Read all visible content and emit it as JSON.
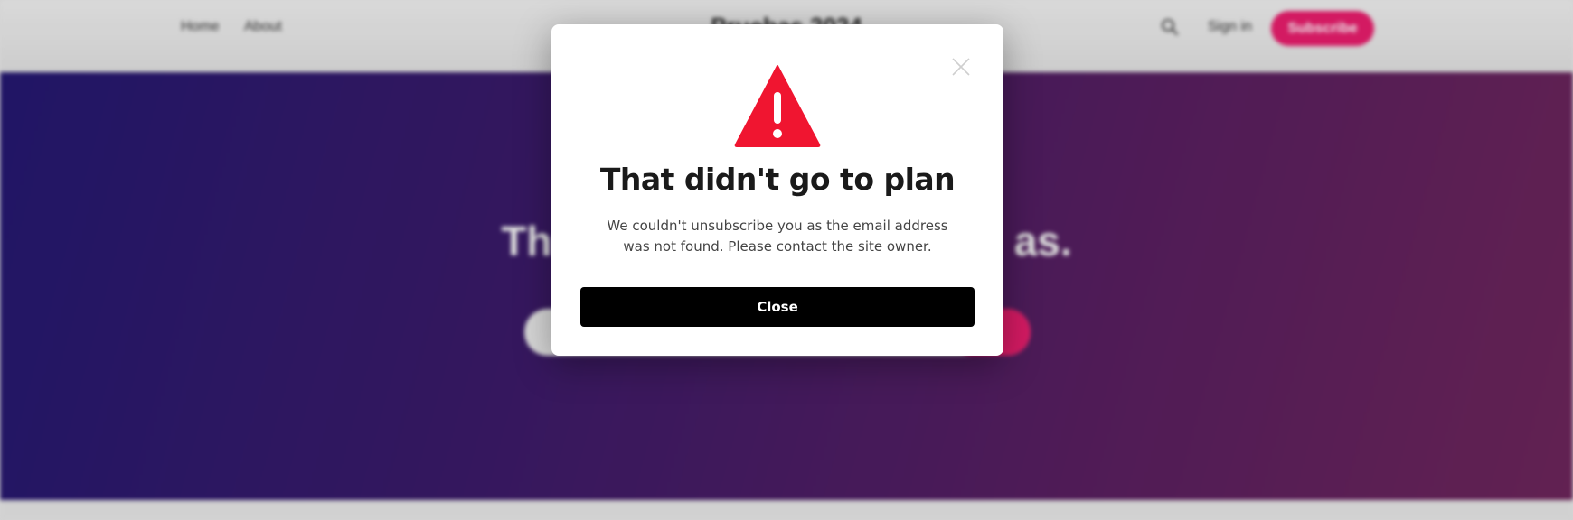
{
  "background": {
    "nav": {
      "links": [
        "Home",
        "About"
      ],
      "site_title": "Pruebas 2024",
      "search_icon": "search-icon",
      "sign_in": "Sign in",
      "subscribe": "Subscribe"
    },
    "hero": {
      "headline": "Th                                        as."
    },
    "colors": {
      "accent": "#e51d6b",
      "hero_gradient_start": "#23176e",
      "hero_gradient_end": "#6b2459"
    }
  },
  "modal": {
    "icon": "warning-triangle-icon",
    "icon_color": "#f01530",
    "title": "That didn't go to plan",
    "message": "We couldn't unsubscribe you as the email address was not found. Please contact the site owner.",
    "close_button": "Close",
    "close_icon": "close-icon"
  }
}
